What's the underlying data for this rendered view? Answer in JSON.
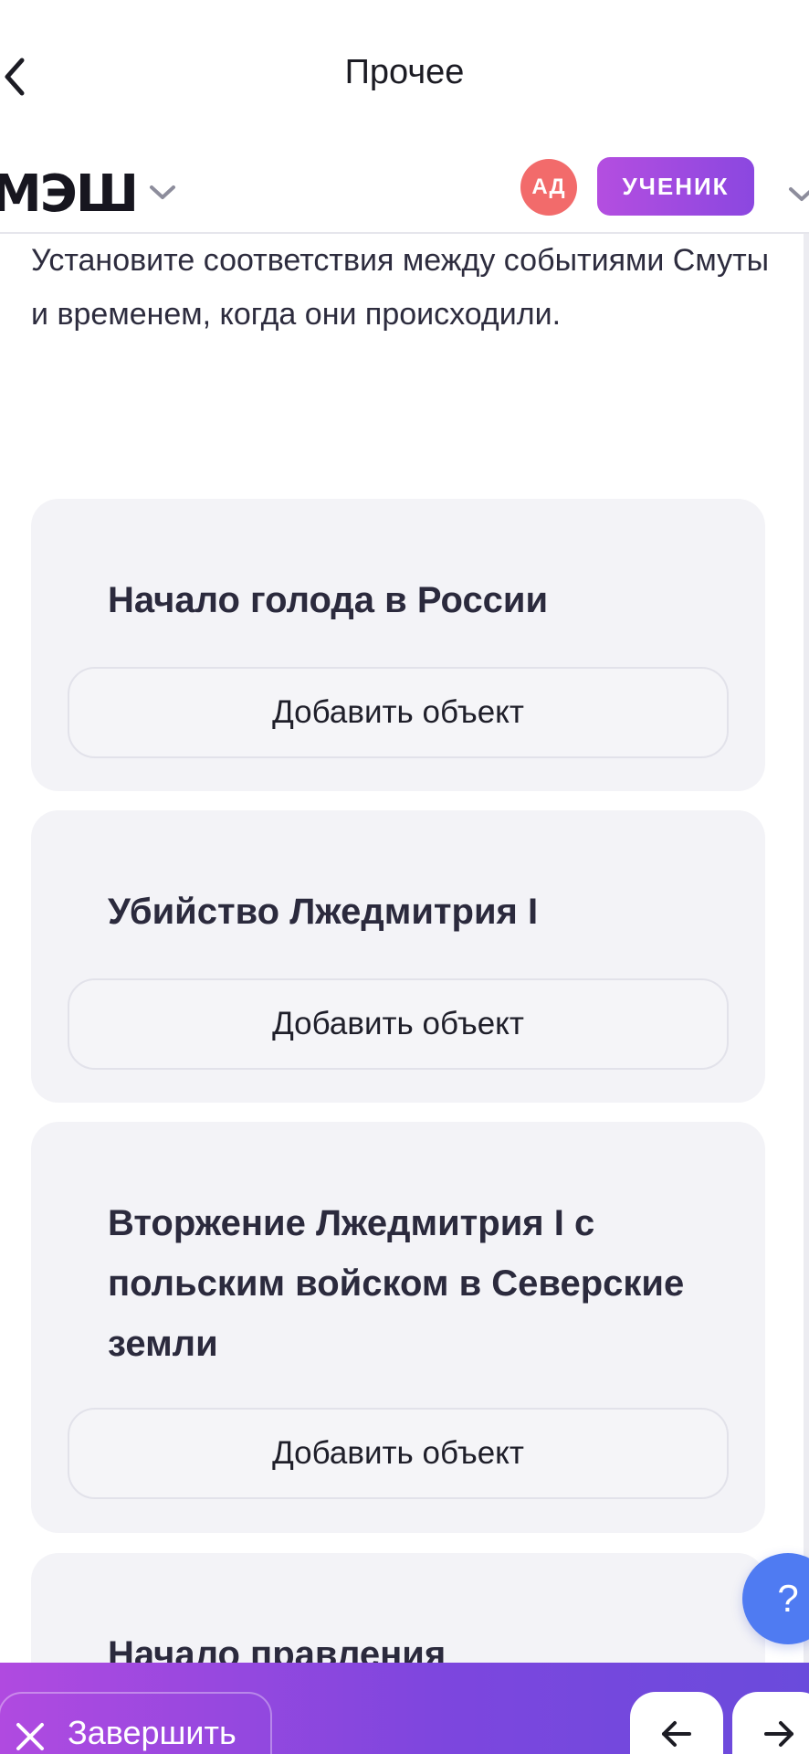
{
  "nav": {
    "title": "Прочее"
  },
  "header": {
    "logo": "МЭШ",
    "avatar_initials": "АД",
    "role_badge": "УЧЕНИК"
  },
  "task": {
    "instruction": "Установите соответствия между событиями Смуты и временем, когда они происходили."
  },
  "cards": [
    {
      "title": "Начало голода в России",
      "button": "Добавить объект"
    },
    {
      "title": "Убийство Лжедмитрия I",
      "button": "Добавить объект"
    },
    {
      "title": "Вторжение Лжедмитрия I с польским войском в Северские земли",
      "button": "Добавить объект"
    },
    {
      "title": "Начало правления"
    }
  ],
  "help": {
    "label": "?"
  },
  "footer": {
    "finish_label": "Завершить"
  },
  "colors": {
    "accent_gradient_start": "#b04ae0",
    "accent_gradient_end": "#6a4bdc",
    "avatar": "#f26b6b",
    "help_button": "#4f7bf2",
    "card_background": "#f3f3f7"
  },
  "icons": {
    "back": "chevron-left-icon",
    "dropdown": "chevron-down-icon",
    "finish": "close-icon",
    "prev": "arrow-left-icon",
    "next": "arrow-right-icon"
  }
}
